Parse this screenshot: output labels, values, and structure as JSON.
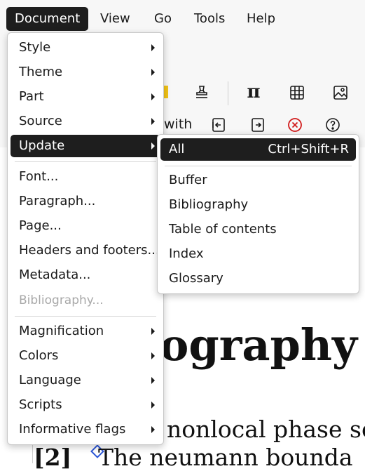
{
  "menubar": {
    "items": [
      "Document",
      "View",
      "Go",
      "Tools",
      "Help"
    ]
  },
  "toolbar": {
    "with_text": "with",
    "icons": [
      "highlight-icon",
      "stamp-icon",
      "pi-icon",
      "table-icon",
      "image-icon",
      "fold-left-icon",
      "fold-right-icon",
      "cancel-icon",
      "help-icon"
    ],
    "pi_glyph": "π",
    "cancel_color": "#d11a1a"
  },
  "document_menu": {
    "items": [
      {
        "label": "Style",
        "submenu": true
      },
      {
        "label": "Theme",
        "submenu": true
      },
      {
        "label": "Part",
        "submenu": true
      },
      {
        "label": "Source",
        "submenu": true
      },
      {
        "label": "Update",
        "submenu": true,
        "active": true
      },
      {
        "label": "Font...",
        "submenu": false
      },
      {
        "label": "Paragraph...",
        "submenu": false
      },
      {
        "label": "Page...",
        "submenu": false
      },
      {
        "label": "Headers and footers...",
        "submenu": false
      },
      {
        "label": "Metadata...",
        "submenu": false
      },
      {
        "label": "Bibliography...",
        "submenu": false,
        "disabled": true
      },
      {
        "label": "Magnification",
        "submenu": true
      },
      {
        "label": "Colors",
        "submenu": true
      },
      {
        "label": "Language",
        "submenu": true
      },
      {
        "label": "Scripts",
        "submenu": true
      },
      {
        "label": "Informative flags",
        "submenu": true
      }
    ]
  },
  "update_menu": {
    "items": [
      {
        "label": "All",
        "shortcut": "Ctrl+Shift+R",
        "active": true
      },
      {
        "label": "Buffer"
      },
      {
        "label": "Bibliography"
      },
      {
        "label": "Table of contents"
      },
      {
        "label": "Index"
      },
      {
        "label": "Glossary"
      }
    ]
  },
  "document": {
    "heading_fragment": "ography",
    "line1_fragment": "nonlocal phase se",
    "ref_label": "[2]",
    "line2_fragment": "The neumann bounda"
  }
}
